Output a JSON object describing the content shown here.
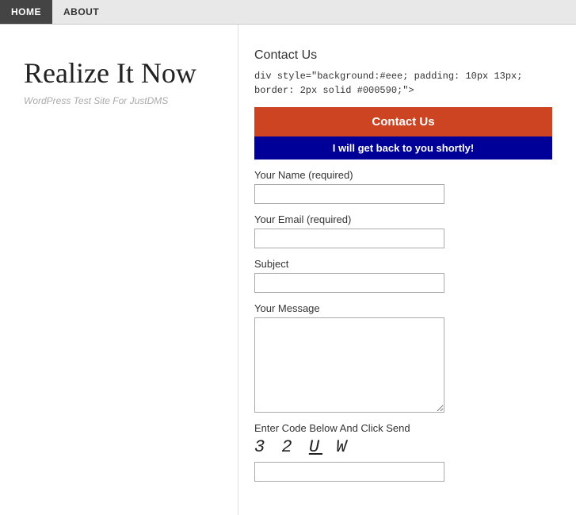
{
  "nav": {
    "items": [
      {
        "label": "HOME",
        "active": true
      },
      {
        "label": "ABOUT",
        "active": false
      }
    ]
  },
  "site": {
    "title": "Realize It Now",
    "subtitle": "WordPress Test Site For JustDMS"
  },
  "contact": {
    "section_title": "Contact Us",
    "code_snippet": "div style=\"background:#eee; padding: 10px 13px; border: 2px solid #000590;\">",
    "button_label": "Contact Us",
    "confirmation_text": "I will get back to you shortly!",
    "fields": {
      "name_label": "Your Name (required)",
      "email_label": "Your Email (required)",
      "subject_label": "Subject",
      "message_label": "Your Message"
    },
    "captcha": {
      "label": "Enter Code Below And Click Send",
      "code": "3 2 U W"
    }
  }
}
